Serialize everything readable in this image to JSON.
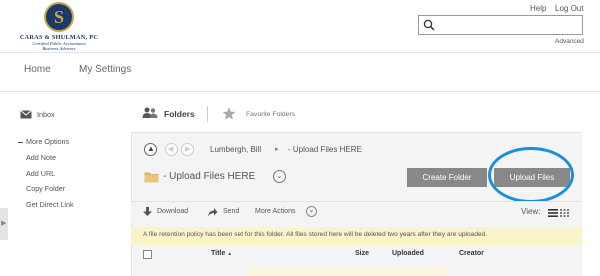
{
  "header": {
    "logo_initial": "S",
    "logo_name": "CARAS & SHULMAN, PC",
    "logo_tagline_1": "Certified Public Accountants",
    "logo_tagline_2": "Business Advisors",
    "help_label": "Help",
    "logout_label": "Log Out",
    "search_placeholder": "",
    "advanced_label": "Advanced"
  },
  "nav": {
    "home_label": "Home",
    "settings_label": "My Settings"
  },
  "sidebar": {
    "inbox_label": "Inbox",
    "more_options_label": "More Options",
    "options": [
      "Add Note",
      "Add URL",
      "Copy Folder",
      "Get Direct Link"
    ]
  },
  "folders_bar": {
    "folders_label": "Folders",
    "favorite_label": "Favorite Folders"
  },
  "panel": {
    "breadcrumb_parent": "Lumbergh, Bill",
    "breadcrumb_sep": "▸",
    "breadcrumb_current": "- Upload Files HERE",
    "folder_title": "- Upload Files HERE",
    "create_folder_label": "Create Folder",
    "upload_files_label": "Upload Files"
  },
  "toolbar": {
    "download_label": "Download",
    "send_label": "Send",
    "more_actions_label": "More Actions",
    "view_label": "View:"
  },
  "notice": "A file retention policy has been set for this folder. All files stored here will be deleted two years after they are uploaded.",
  "columns": {
    "title": "Title",
    "sort_arrow": "▲",
    "size": "Size",
    "uploaded": "Uploaded",
    "creator": "Creator"
  },
  "colors": {
    "brand_navy": "#1a3a6b",
    "brand_gold": "#c7a548",
    "highlight_ring": "#1e8fd6",
    "notice_bg": "#fbf4c9",
    "button_gray": "#888888"
  }
}
